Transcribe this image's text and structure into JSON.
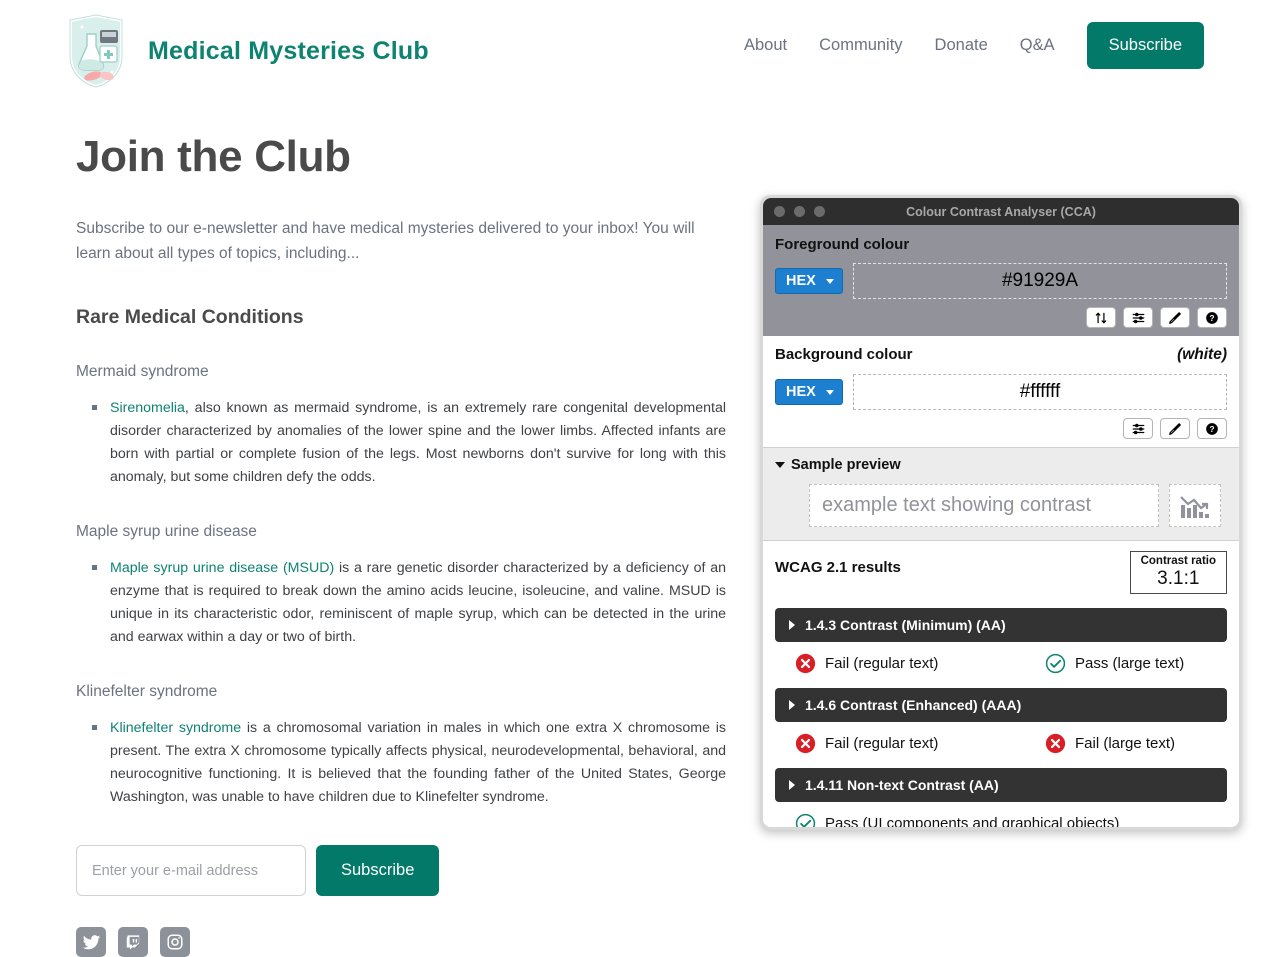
{
  "site": {
    "brand_name": "Medical Mysteries Club",
    "brand_color": "#0e8372",
    "accent_color": "#03796a",
    "nav": [
      {
        "label": "About"
      },
      {
        "label": "Community"
      },
      {
        "label": "Donate"
      },
      {
        "label": "Q&A"
      }
    ],
    "nav_cta": "Subscribe"
  },
  "main": {
    "title": "Join the Club",
    "intro": "Subscribe to our e-newsletter and have medical mysteries delivered to your inbox! You will learn about all types of topics, including...",
    "section_title": "Rare Medical Conditions",
    "conditions": [
      {
        "heading": "Mermaid syndrome",
        "link_text": "Sirenomelia",
        "body": ", also known as mermaid syndrome, is an extremely rare congenital developmental disorder characterized by anomalies of the lower spine and the lower limbs. Affected infants are born with partial or complete fusion of the legs. Most newborns don't survive for long with this anomaly, but some children defy the odds."
      },
      {
        "heading": "Maple syrup urine disease",
        "link_text": "Maple syrup urine disease (MSUD)",
        "body": " is a rare genetic disorder characterized by a deficiency of an enzyme that is required to break down the amino acids leucine, isoleucine, and valine. MSUD is unique in its characteristic odor, reminiscent of maple syrup, which can be detected in the urine and earwax within a day or two of birth."
      },
      {
        "heading": "Klinefelter syndrome",
        "link_text": "Klinefelter syndrome",
        "body": " is a chromosomal variation in males in which one extra X chromosome is present. The extra X chromosome typically affects physical, neurodevelopmental, behavioral, and neurocognitive functioning. It is believed that the founding father of the United States, George Washington, was unable to have children due to Klinefelter syndrome."
      }
    ],
    "email_placeholder": "Enter your e-mail address",
    "email_value": "",
    "subscribe_label": "Subscribe",
    "socials": [
      {
        "name": "twitter-icon"
      },
      {
        "name": "twitch-icon"
      },
      {
        "name": "instagram-icon"
      }
    ]
  },
  "cca": {
    "window_title": "Colour Contrast Analyser (CCA)",
    "foreground": {
      "label": "Foreground colour",
      "format": "HEX",
      "value": "#91929A",
      "swatch": "#91929A",
      "buttons": [
        "swap-icon",
        "sliders-icon",
        "eyedropper-icon",
        "help-icon"
      ]
    },
    "background": {
      "label": "Background colour",
      "note": "(white)",
      "format": "HEX",
      "value": "#ffffff",
      "buttons": [
        "sliders-icon",
        "eyedropper-icon",
        "help-icon"
      ]
    },
    "preview": {
      "label": "Sample preview",
      "sample_text": "example text showing contrast"
    },
    "results": {
      "title": "WCAG 2.1 results",
      "ratio_label": "Contrast ratio",
      "ratio_value": "3.1:1",
      "criteria": [
        {
          "name": "1.4.3 Contrast (Minimum) (AA)",
          "results": [
            {
              "status": "fail",
              "text": "Fail (regular text)"
            },
            {
              "status": "pass",
              "text": "Pass (large text)"
            }
          ]
        },
        {
          "name": "1.4.6 Contrast (Enhanced) (AAA)",
          "results": [
            {
              "status": "fail",
              "text": "Fail (regular text)"
            },
            {
              "status": "fail",
              "text": "Fail (large text)"
            }
          ]
        },
        {
          "name": "1.4.11 Non-text Contrast (AA)",
          "results": [
            {
              "status": "pass",
              "text": "Pass (UI components and graphical objects)"
            }
          ]
        }
      ]
    }
  }
}
